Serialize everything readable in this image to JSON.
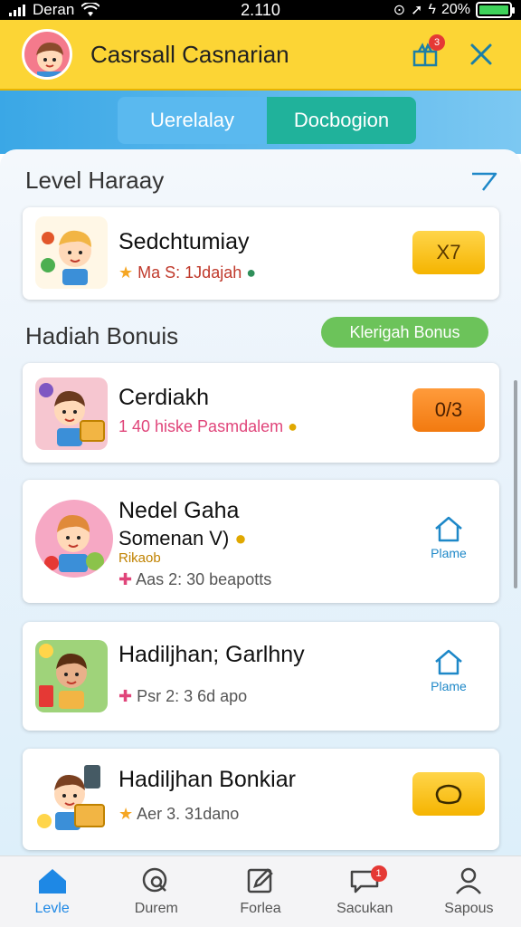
{
  "status_bar": {
    "carrier": "Deran",
    "time": "2.110",
    "battery": "20%"
  },
  "header": {
    "title": "Casrsall Casnarian",
    "notification_count": "3"
  },
  "tabs": [
    {
      "label": "Uerelalay"
    },
    {
      "label": "Docbogion"
    }
  ],
  "section_level": {
    "title": "Level Haraay"
  },
  "section_bonus": {
    "title": "Hadiah Bonuis",
    "pill_label": "Klerigah Bonus"
  },
  "cards": [
    {
      "title": "Sedchtumiay",
      "meta_prefix": "★",
      "meta": "Ma S: 1Jdajah",
      "badge": "X7",
      "badge_color": "yellow"
    },
    {
      "title": "Cerdiakh",
      "meta": "1 40 hiske Pasmdalem",
      "badge": "0/3",
      "badge_color": "orange"
    },
    {
      "title": "Nedel Gaha",
      "subtitle": "Somenan V)",
      "tag": "Rikaob",
      "meta_prefix": "✚",
      "meta": "Aas 2: 30 beapotts",
      "action_label": "Plame"
    },
    {
      "title": "Hadiljhan; Garlhny",
      "meta_prefix": "✚",
      "meta": "Psr 2: 3 6d apo",
      "action_label": "Plame"
    },
    {
      "title": "Hadiljhan Bonkiar",
      "meta_prefix": "★",
      "meta": "Aer 3. 31dano",
      "badge_color": "yellow"
    }
  ],
  "bottom_nav": [
    {
      "label": "Levle",
      "icon": "home-icon",
      "active": true
    },
    {
      "label": "Durem",
      "icon": "chat-search-icon"
    },
    {
      "label": "Forlea",
      "icon": "edit-icon"
    },
    {
      "label": "Sacukan",
      "icon": "message-icon",
      "badge": "1"
    },
    {
      "label": "Sapous",
      "icon": "profile-icon"
    }
  ],
  "colors": {
    "header_bg": "#fcd535",
    "band_blue": "#3aa7e6",
    "tab_active": "#5ab9ef",
    "tab_inactive": "#20b29b",
    "pill_green": "#6cc35a",
    "badge_yellow": "#f5b400",
    "badge_orange": "#f27a10",
    "nav_active": "#1e88e5"
  }
}
